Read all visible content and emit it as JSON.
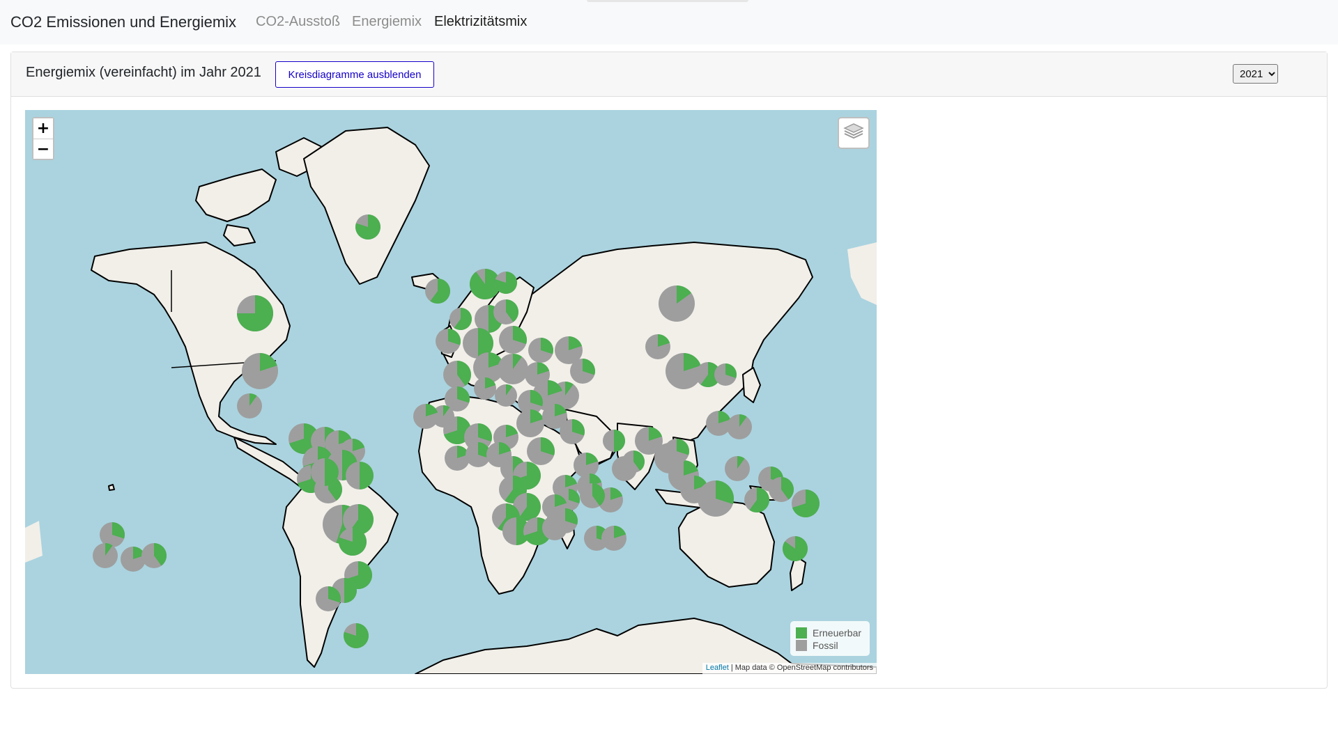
{
  "navbar": {
    "brand": "CO2 Emissionen und Energiemix",
    "links": [
      {
        "label": "CO2-Ausstoß",
        "active": false
      },
      {
        "label": "Energiemix",
        "active": false
      },
      {
        "label": "Elektrizitätsmix",
        "active": true
      }
    ]
  },
  "card": {
    "title": "Energiemix (vereinfacht) im Jahr 2021",
    "toggle_button": "Kreisdiagramme ausblenden",
    "year_select": {
      "selected": "2021"
    }
  },
  "map": {
    "zoom_in": "+",
    "zoom_out": "−",
    "layers_icon": "layers-icon",
    "legend": {
      "renewable_label": "Erneuerbar",
      "fossil_label": "Fossil",
      "renewable_color": "#4caf50",
      "fossil_color": "#9e9e9e"
    },
    "attribution": {
      "link": "Leaflet",
      "text": " | Map data © OpenStreetMap contributors"
    }
  },
  "colors": {
    "water": "#aad3df",
    "land": "#f2efe9",
    "border": "#000000"
  }
}
